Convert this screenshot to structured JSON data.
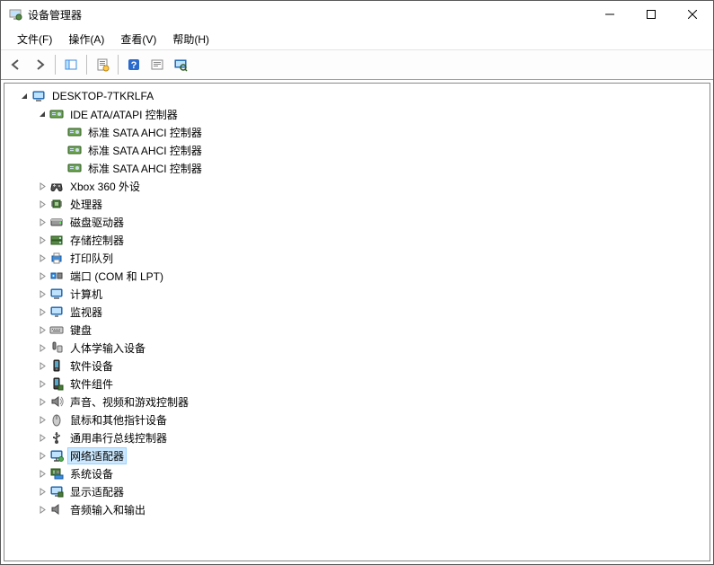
{
  "window": {
    "title": "设备管理器"
  },
  "menu": {
    "file": "文件(F)",
    "action": "操作(A)",
    "view": "查看(V)",
    "help": "帮助(H)"
  },
  "tree": {
    "root": "DESKTOP-7TKRLFA",
    "categories": [
      {
        "label": "IDE ATA/ATAPI 控制器",
        "icon": "hdd-controller-icon",
        "expanded": true,
        "children": [
          {
            "label": "标准 SATA AHCI 控制器",
            "icon": "hdd-controller-icon"
          },
          {
            "label": "标准 SATA AHCI 控制器",
            "icon": "hdd-controller-icon"
          },
          {
            "label": "标准 SATA AHCI 控制器",
            "icon": "hdd-controller-icon"
          }
        ]
      },
      {
        "label": "Xbox 360 外设",
        "icon": "gamepad-icon"
      },
      {
        "label": "处理器",
        "icon": "cpu-icon"
      },
      {
        "label": "磁盘驱动器",
        "icon": "disk-icon"
      },
      {
        "label": "存储控制器",
        "icon": "storage-controller-icon"
      },
      {
        "label": "打印队列",
        "icon": "printer-icon"
      },
      {
        "label": "端口 (COM 和 LPT)",
        "icon": "port-icon"
      },
      {
        "label": "计算机",
        "icon": "computer-icon"
      },
      {
        "label": "监视器",
        "icon": "monitor-icon"
      },
      {
        "label": "键盘",
        "icon": "keyboard-icon"
      },
      {
        "label": "人体学输入设备",
        "icon": "hid-icon"
      },
      {
        "label": "软件设备",
        "icon": "software-device-icon"
      },
      {
        "label": "软件组件",
        "icon": "software-component-icon"
      },
      {
        "label": "声音、视频和游戏控制器",
        "icon": "sound-icon"
      },
      {
        "label": "鼠标和其他指针设备",
        "icon": "mouse-icon"
      },
      {
        "label": "通用串行总线控制器",
        "icon": "usb-icon"
      },
      {
        "label": "网络适配器",
        "icon": "network-icon",
        "selected": true
      },
      {
        "label": "系统设备",
        "icon": "system-device-icon"
      },
      {
        "label": "显示适配器",
        "icon": "display-adapter-icon"
      },
      {
        "label": "音频输入和输出",
        "icon": "audio-io-icon"
      }
    ]
  }
}
